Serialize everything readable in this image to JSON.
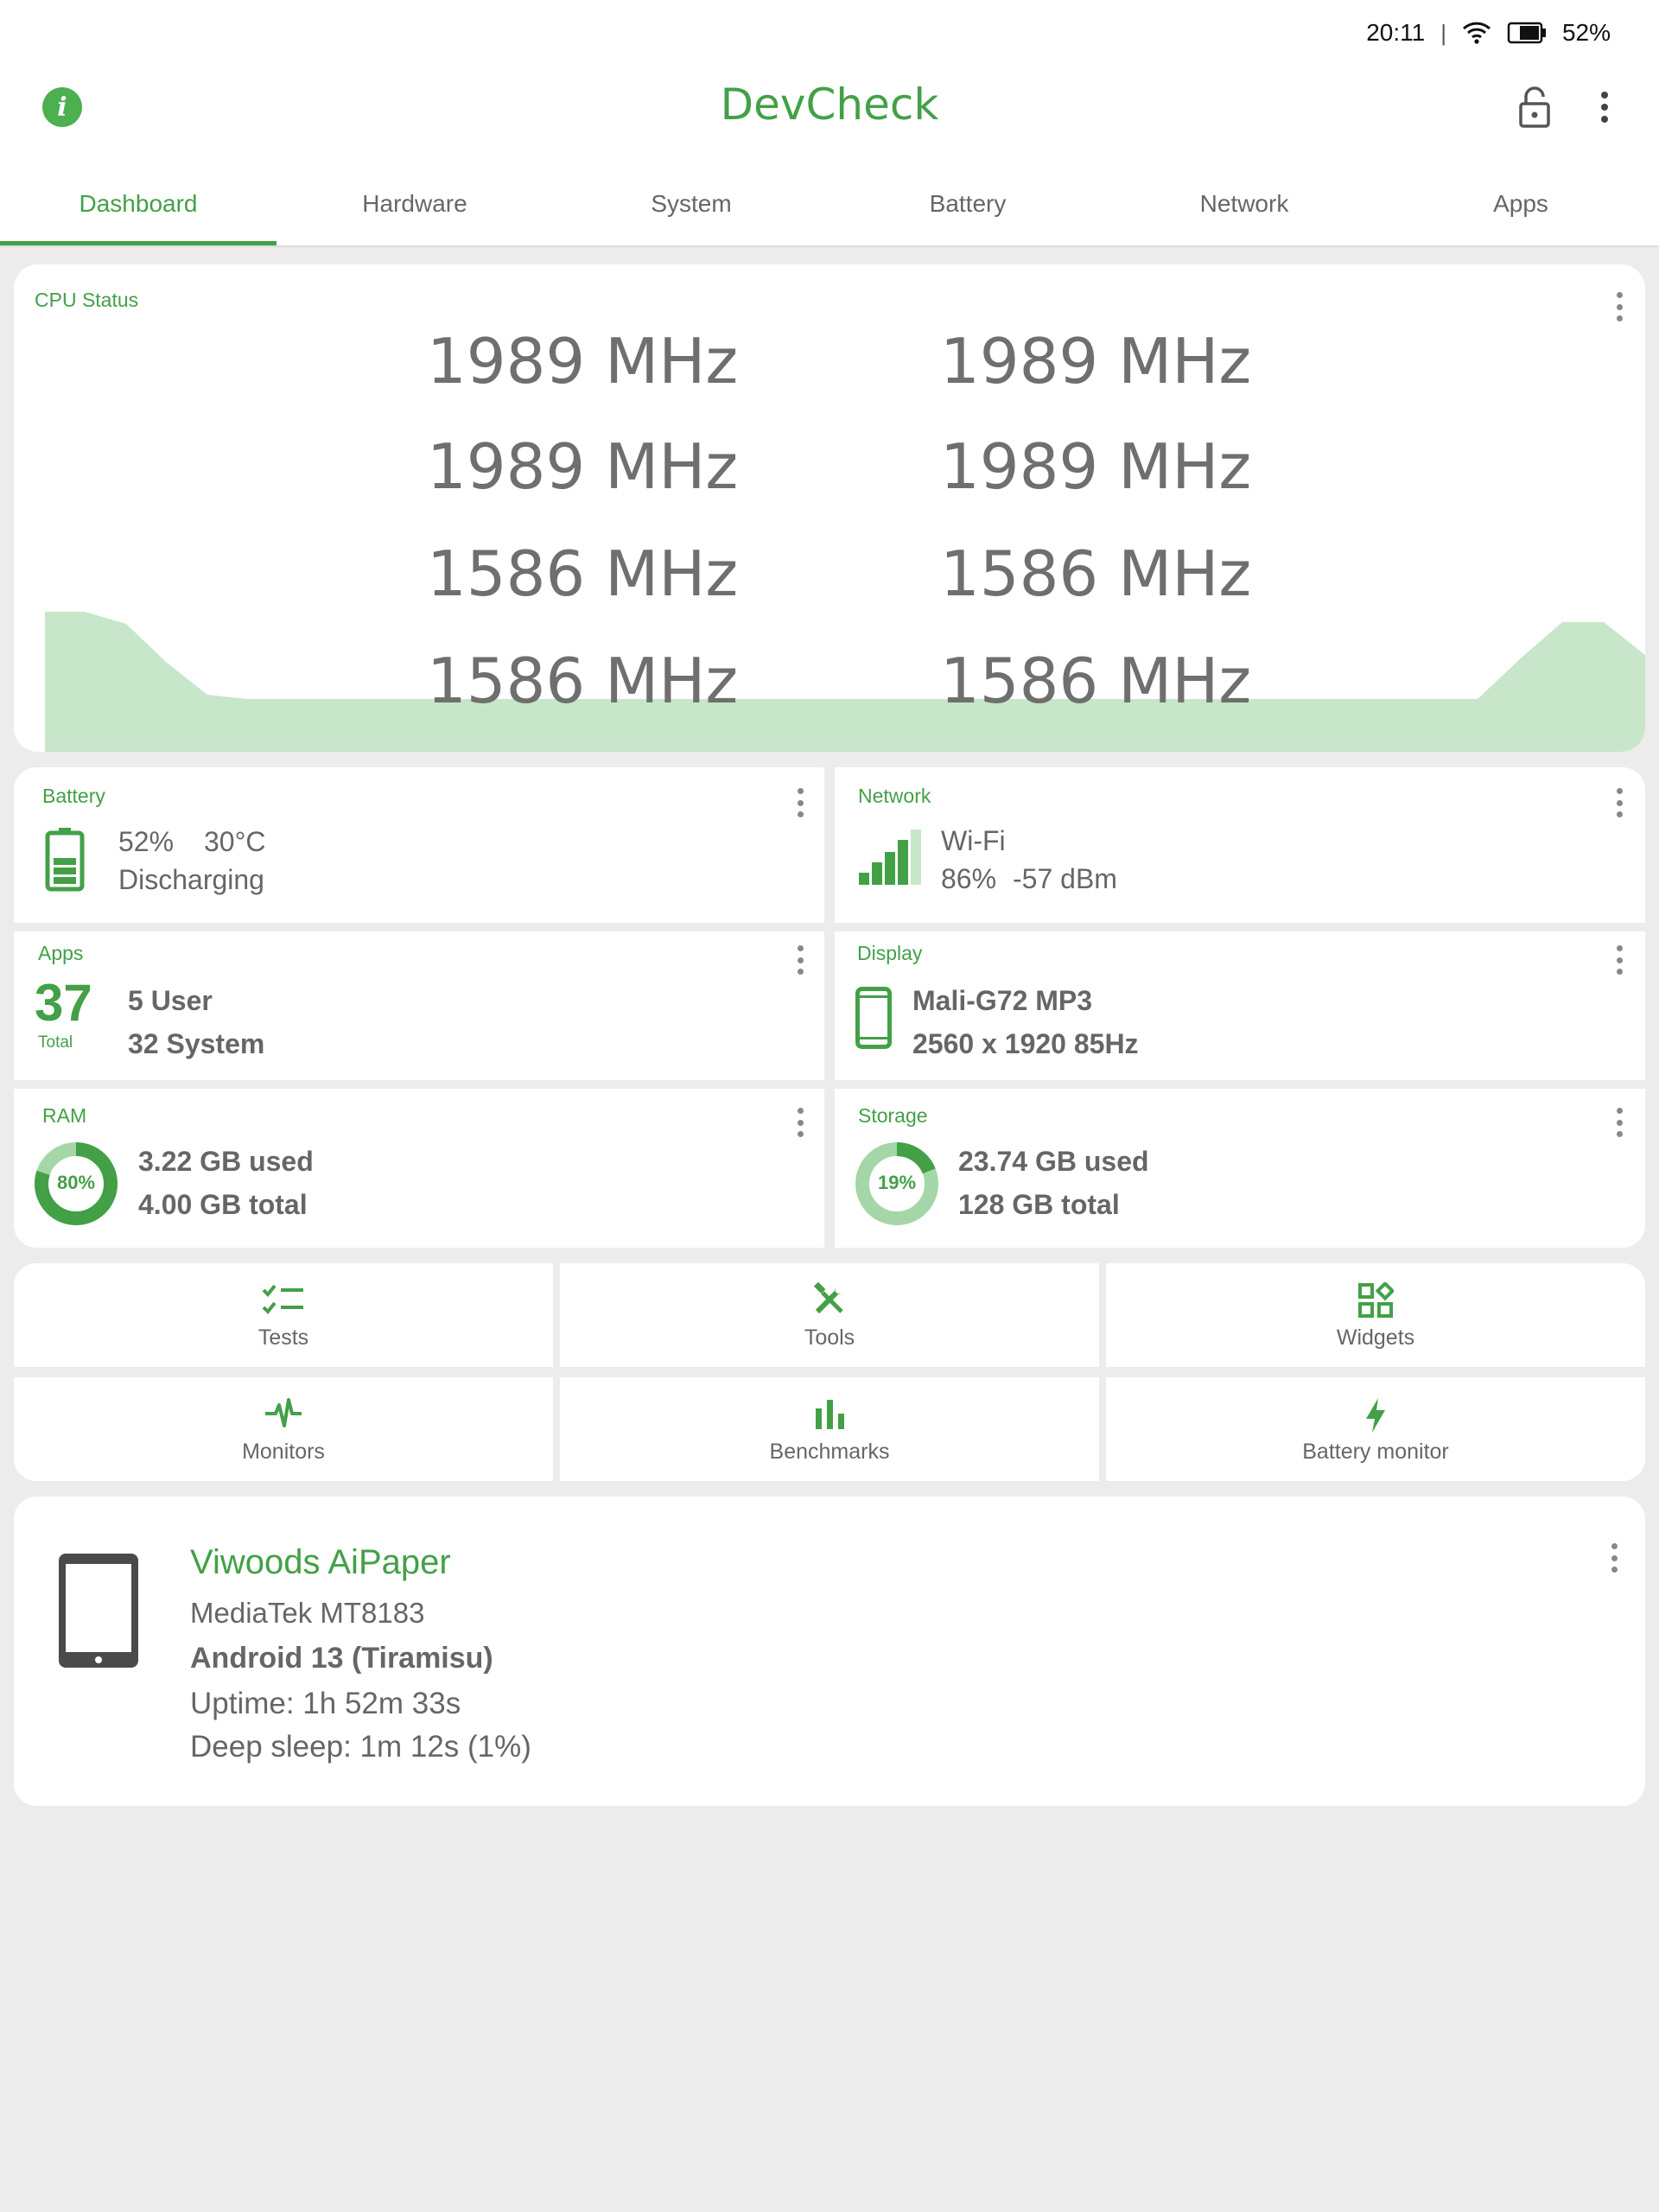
{
  "status_bar": {
    "time": "20:11",
    "separator": "|",
    "battery_pct": "52%"
  },
  "app": {
    "title": "DevCheck",
    "info_label": "i"
  },
  "tabs": [
    {
      "label": "Dashboard",
      "active": true
    },
    {
      "label": "Hardware"
    },
    {
      "label": "System"
    },
    {
      "label": "Battery"
    },
    {
      "label": "Network"
    },
    {
      "label": "Apps"
    }
  ],
  "cpu": {
    "title": "CPU Status",
    "cores": [
      "1989 MHz",
      "1989 MHz",
      "1989 MHz",
      "1989 MHz",
      "1586 MHz",
      "1586 MHz",
      "1586 MHz",
      "1586 MHz"
    ],
    "graph_color": "#c8e6c9"
  },
  "battery": {
    "title": "Battery",
    "percent": "52%",
    "temp": "30°C",
    "state": "Discharging"
  },
  "network": {
    "title": "Network",
    "type": "Wi-Fi",
    "signal": "86%",
    "dbm": "-57 dBm"
  },
  "apps": {
    "title": "Apps",
    "total": "37",
    "total_label": "Total",
    "user": "5 User",
    "system": "32 System"
  },
  "display": {
    "title": "Display",
    "gpu": "Mali-G72 MP3",
    "resolution": "2560 x 1920  85Hz"
  },
  "ram": {
    "title": "RAM",
    "percent_label": "80%",
    "percent": 80,
    "used": "3.22 GB used",
    "total": "4.00 GB total"
  },
  "storage": {
    "title": "Storage",
    "percent_label": "19%",
    "percent": 19,
    "used": "23.74 GB used",
    "total": "128 GB total"
  },
  "actions": [
    {
      "label": "Tests",
      "icon": "checklist-icon"
    },
    {
      "label": "Tools",
      "icon": "tools-icon"
    },
    {
      "label": "Widgets",
      "icon": "widgets-icon"
    },
    {
      "label": "Monitors",
      "icon": "pulse-icon"
    },
    {
      "label": "Benchmarks",
      "icon": "bar-chart-icon"
    },
    {
      "label": "Battery monitor",
      "icon": "bolt-icon"
    }
  ],
  "device": {
    "name": "Viwoods AiPaper",
    "soc": "MediaTek MT8183",
    "os": "Android 13 (Tiramisu)",
    "uptime": "Uptime: 1h 52m 33s",
    "deep_sleep": "Deep sleep: 1m 12s (1%)"
  },
  "colors": {
    "accent": "#43a047",
    "background": "#ececec",
    "card": "#ffffff",
    "graph_fill": "#c8e6c9"
  }
}
